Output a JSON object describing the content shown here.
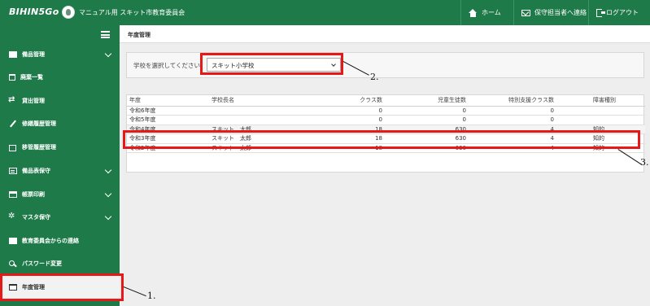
{
  "header": {
    "logo": "BIHIN5Go",
    "org_name": "マニュアル用 スキット市教育委員会",
    "home_label": "ホーム",
    "contact_label": "保守担当者へ連絡",
    "logout_label": "ログアウト"
  },
  "sidebar": {
    "items": [
      {
        "label": "備品管理",
        "icon": "box-icon",
        "chevron": true
      },
      {
        "label": "廃棄一覧",
        "icon": "trash-icon",
        "chevron": false
      },
      {
        "label": "貸出管理",
        "icon": "swap-icon",
        "chevron": false
      },
      {
        "label": "修繕履歴管理",
        "icon": "wrench-icon",
        "chevron": false
      },
      {
        "label": "移管履歴管理",
        "icon": "truck-icon",
        "chevron": false
      },
      {
        "label": "備品表保守",
        "icon": "list-icon",
        "chevron": true
      },
      {
        "label": "帳票印刷",
        "icon": "print-icon",
        "chevron": true
      },
      {
        "label": "マスタ保守",
        "icon": "gear-icon",
        "chevron": true
      },
      {
        "label": "教育委員会からの連絡",
        "icon": "mail-icon",
        "chevron": false
      },
      {
        "label": "パスワード変更",
        "icon": "key-icon",
        "chevron": false
      },
      {
        "label": "年度管理",
        "icon": "calendar-icon",
        "chevron": false,
        "active": true
      }
    ]
  },
  "main": {
    "breadcrumb": "年度管理",
    "school_select": {
      "label": "学校を選択してください。",
      "value": "スキット小学校"
    },
    "table": {
      "headers": [
        "年度",
        "学校長名",
        "クラス数",
        "児童生徒数",
        "特別支援クラス数",
        "障害種別"
      ],
      "rows": [
        [
          "令和6年度",
          "",
          "0",
          "0",
          "0",
          ""
        ],
        [
          "令和5年度",
          "",
          "0",
          "0",
          "0",
          ""
        ],
        [
          "令和4年度",
          "スキット　太郎",
          "18",
          "630",
          "4",
          "知的"
        ],
        [
          "令和3年度",
          "スキット　太郎",
          "18",
          "630",
          "4",
          "知的"
        ],
        [
          "令和2年度",
          "スキット　太郎",
          "18",
          "630",
          "4",
          "知的"
        ]
      ]
    }
  },
  "annotations": [
    "1.",
    "2.",
    "3."
  ],
  "colors": {
    "brand_green": "#1f7a4a",
    "annotation_red": "#e61919"
  }
}
